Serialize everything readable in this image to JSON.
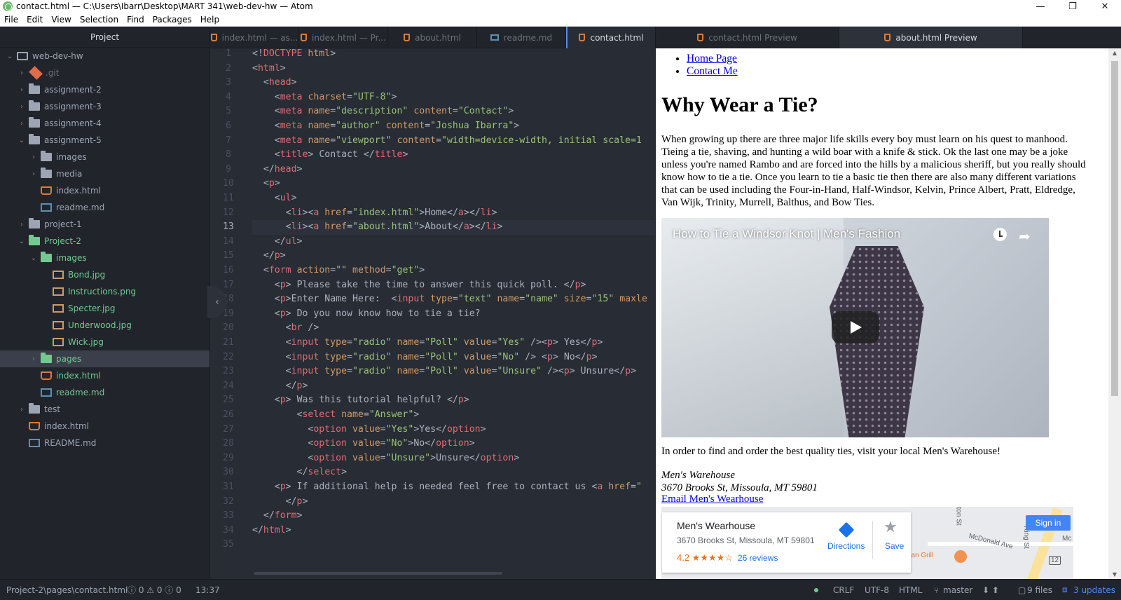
{
  "window": {
    "title": "contact.html — C:\\Users\\Ibarr\\Desktop\\MART 341\\web-dev-hw — Atom",
    "minimize": "—",
    "maximize": "❐",
    "close": "✕"
  },
  "menu": [
    "File",
    "Edit",
    "View",
    "Selection",
    "Find",
    "Packages",
    "Help"
  ],
  "tree": {
    "header": "Project",
    "rows": [
      {
        "label": "web-dev-hw",
        "type": "repo",
        "chev": "⌄",
        "depth": 0,
        "style": ""
      },
      {
        "label": ".git",
        "type": "git",
        "chev": "›",
        "depth": 1,
        "style": "git"
      },
      {
        "label": "assignment-2",
        "type": "folder",
        "chev": "›",
        "depth": 1,
        "style": ""
      },
      {
        "label": "assignment-3",
        "type": "folder",
        "chev": "›",
        "depth": 1,
        "style": ""
      },
      {
        "label": "assignment-4",
        "type": "folder",
        "chev": "›",
        "depth": 1,
        "style": ""
      },
      {
        "label": "assignment-5",
        "type": "folder",
        "chev": "⌄",
        "depth": 1,
        "style": ""
      },
      {
        "label": "images",
        "type": "folder",
        "chev": "›",
        "depth": 2,
        "style": ""
      },
      {
        "label": "media",
        "type": "folder",
        "chev": "›",
        "depth": 2,
        "style": ""
      },
      {
        "label": "index.html",
        "type": "html",
        "chev": "",
        "depth": 2,
        "style": ""
      },
      {
        "label": "readme.md",
        "type": "md",
        "chev": "",
        "depth": 2,
        "style": ""
      },
      {
        "label": "project-1",
        "type": "folder",
        "chev": "›",
        "depth": 1,
        "style": ""
      },
      {
        "label": "Project-2",
        "type": "folder-green",
        "chev": "⌄",
        "depth": 1,
        "style": "green"
      },
      {
        "label": "images",
        "type": "folder-green",
        "chev": "⌄",
        "depth": 2,
        "style": "green"
      },
      {
        "label": "Bond.jpg",
        "type": "img",
        "chev": "",
        "depth": 3,
        "style": "green"
      },
      {
        "label": "Instructions.png",
        "type": "img",
        "chev": "",
        "depth": 3,
        "style": "green"
      },
      {
        "label": "Specter.jpg",
        "type": "img",
        "chev": "",
        "depth": 3,
        "style": "green"
      },
      {
        "label": "Underwood.jpg",
        "type": "img",
        "chev": "",
        "depth": 3,
        "style": "green"
      },
      {
        "label": "Wick.jpg",
        "type": "img",
        "chev": "",
        "depth": 3,
        "style": "green"
      },
      {
        "label": "pages",
        "type": "folder-green",
        "chev": "›",
        "depth": 2,
        "style": "green",
        "selected": true
      },
      {
        "label": "index.html",
        "type": "html",
        "chev": "",
        "depth": 2,
        "style": "green"
      },
      {
        "label": "readme.md",
        "type": "md",
        "chev": "",
        "depth": 2,
        "style": "green"
      },
      {
        "label": "test",
        "type": "folder",
        "chev": "›",
        "depth": 1,
        "style": ""
      },
      {
        "label": "index.html",
        "type": "html",
        "chev": "",
        "depth": 1,
        "style": ""
      },
      {
        "label": "README.md",
        "type": "md",
        "chev": "",
        "depth": 1,
        "style": ""
      }
    ]
  },
  "tabs": [
    {
      "label": "index.html — as...",
      "icon": "html",
      "active": false
    },
    {
      "label": "index.html — Pr...",
      "icon": "html",
      "active": false
    },
    {
      "label": "about.html",
      "icon": "html",
      "active": false
    },
    {
      "label": "readme.md",
      "icon": "md",
      "active": false
    },
    {
      "label": "contact.html",
      "icon": "html",
      "active": true
    },
    {
      "label": "contact.html Preview",
      "icon": "html",
      "active": false
    },
    {
      "label": "about.html Preview",
      "icon": "html",
      "active": false
    }
  ],
  "editor": {
    "current_line": 13,
    "lines": [
      "<!DOCTYPE html>",
      "<html>",
      "  <head>",
      "    <meta charset=\"UTF-8\">",
      "    <meta name=\"description\" content=\"Contact\">",
      "    <meta name=\"author\" content=\"Joshua Ibarra\">",
      "    <meta name=\"viewport\" content=\"width=device-width, initial scale=1",
      "    <title> Contact </title>",
      "  </head>",
      "  <p>",
      "    <ul>",
      "      <li><a href=\"index.html\">Home</a></li>",
      "      <li><a href=\"about.html\">About</a></li>",
      "    </ul>",
      "  </p>",
      "  <form action=\"\" method=\"get\">",
      "    <p> Please take the time to answer this quick poll. </p>",
      "    <p>Enter Name Here:  <input type=\"text\" name=\"name\" size=\"15\" maxle",
      "    <p> Do you now know how to tie a tie?",
      "      <br />",
      "      <input type=\"radio\" name=\"Poll\" value=\"Yes\" /><p> Yes</p>",
      "      <input type=\"radio\" name=\"Poll\" value=\"No\" /> <p> No</p>",
      "      <input type=\"radio\" name=\"Poll\" value=\"Unsure\" /><p> Unsure</p>",
      "      </p>",
      "    <p> Was this tutorial helpful? </p>",
      "        <select name=\"Answer\">",
      "          <option value=\"Yes\">Yes</option>",
      "          <option value=\"No\">No</option>",
      "          <option value=\"Unsure\">Unsure</option>",
      "        </select>",
      "    <p> If additional help is needed feel free to contact us <a href=\"",
      "      </p>",
      "  </form>",
      "</html>",
      ""
    ]
  },
  "preview": {
    "nav": [
      "Home Page",
      "Contact Me"
    ],
    "heading": "Why Wear a Tie?",
    "paragraph": "When growing up there are three major life skills every boy must learn on his quest to manhood. Tieing a tie, shaving, and hunting a wild boar with a knife & stick. Ok the last one may be a joke unless you're named Rambo and are forced into the hills by a malicious sheriff, but you really should know how to tie a tie. Once you learn to tie a basic tie then there are also many different variations that can be used including the Four-in-Hand, Half-Windsor, Kelvin, Prince Albert, Pratt, Eldredge, Van Wijk, Trinity, Murrell, Balthus, and Bow Ties.",
    "video_title": "How to Tie a Windsor Knot | Men's Fashion",
    "paragraph2": "In order to find and order the best quality ties, visit your local Men's Warehouse!",
    "address_line1": "Men's Warehouse",
    "address_line2": "3670 Brooks St, Missoula, MT 59801",
    "email_link": "Email Men's Wearhouse",
    "map": {
      "place": "Men's Wearhouse",
      "address": "3670 Brooks St, Missoula, MT 59801",
      "rating": "4.2 ★★★★☆",
      "reviews": "26 reviews",
      "directions": "Directions",
      "save": "Save",
      "signin": "Sign in",
      "labels": [
        "Eaton St",
        "McDonald Ave",
        "Ring St",
        "lian Grill",
        "Mc",
        "12"
      ]
    }
  },
  "status": {
    "path": "Project-2\\pages\\contact.html",
    "diagnostics": "ⓘ 0 ⚠ 0 ⓘ 0",
    "cursor": "13:37",
    "line_ending": "CRLF",
    "encoding": "UTF-8",
    "grammar": "HTML",
    "branch": "master",
    "fetch": "⬇ ⬆",
    "files": "9 files",
    "updates": "3 updates"
  }
}
